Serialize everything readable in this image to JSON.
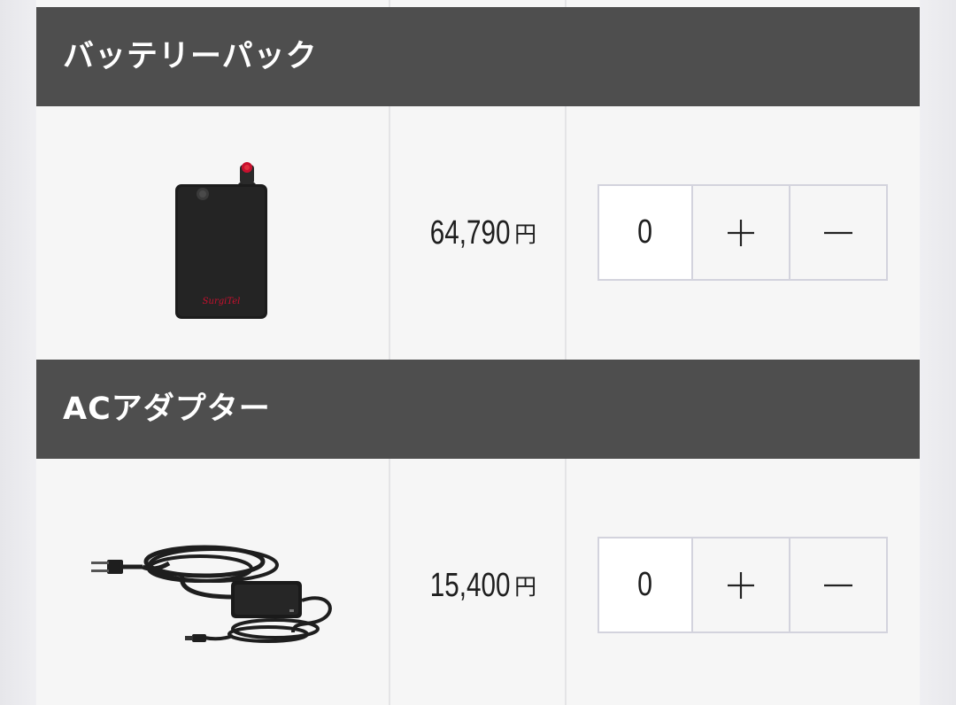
{
  "products": [
    {
      "title": "バッテリーパック",
      "image_icon": "battery-pack-icon",
      "image_label": "SurgiTel",
      "price_value": "64,790",
      "price_unit": "円",
      "quantity": "0",
      "plus_label": "＋",
      "minus_label": "－"
    },
    {
      "title": "ACアダプター",
      "image_icon": "ac-adapter-icon",
      "price_value": "15,400",
      "price_unit": "円",
      "quantity": "0",
      "plus_label": "＋",
      "minus_label": "－"
    }
  ],
  "colors": {
    "header_bg": "#4e4e4e",
    "row_bg": "#f6f6f6",
    "border": "#d3d3dd",
    "accent_red": "#c8102e"
  }
}
